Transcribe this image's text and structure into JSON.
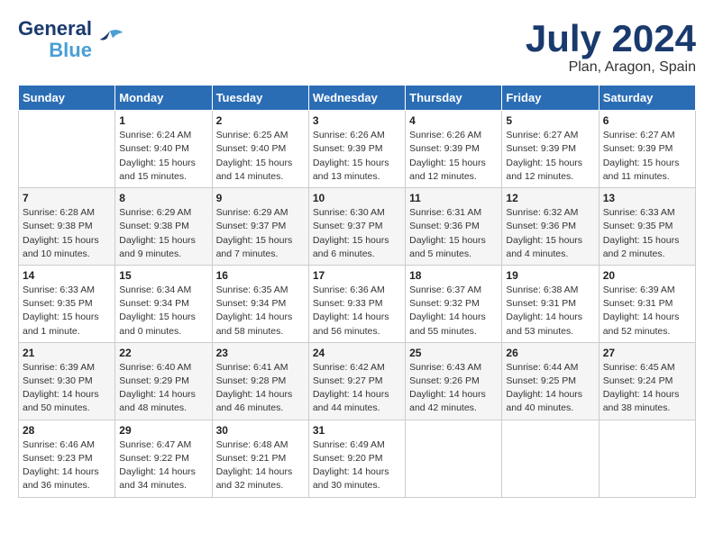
{
  "logo": {
    "line1": "General",
    "line2": "Blue"
  },
  "title": "July 2024",
  "location": "Plan, Aragon, Spain",
  "days_header": [
    "Sunday",
    "Monday",
    "Tuesday",
    "Wednesday",
    "Thursday",
    "Friday",
    "Saturday"
  ],
  "weeks": [
    [
      {
        "num": "",
        "info": ""
      },
      {
        "num": "1",
        "info": "Sunrise: 6:24 AM\nSunset: 9:40 PM\nDaylight: 15 hours\nand 15 minutes."
      },
      {
        "num": "2",
        "info": "Sunrise: 6:25 AM\nSunset: 9:40 PM\nDaylight: 15 hours\nand 14 minutes."
      },
      {
        "num": "3",
        "info": "Sunrise: 6:26 AM\nSunset: 9:39 PM\nDaylight: 15 hours\nand 13 minutes."
      },
      {
        "num": "4",
        "info": "Sunrise: 6:26 AM\nSunset: 9:39 PM\nDaylight: 15 hours\nand 12 minutes."
      },
      {
        "num": "5",
        "info": "Sunrise: 6:27 AM\nSunset: 9:39 PM\nDaylight: 15 hours\nand 12 minutes."
      },
      {
        "num": "6",
        "info": "Sunrise: 6:27 AM\nSunset: 9:39 PM\nDaylight: 15 hours\nand 11 minutes."
      }
    ],
    [
      {
        "num": "7",
        "info": "Sunrise: 6:28 AM\nSunset: 9:38 PM\nDaylight: 15 hours\nand 10 minutes."
      },
      {
        "num": "8",
        "info": "Sunrise: 6:29 AM\nSunset: 9:38 PM\nDaylight: 15 hours\nand 9 minutes."
      },
      {
        "num": "9",
        "info": "Sunrise: 6:29 AM\nSunset: 9:37 PM\nDaylight: 15 hours\nand 7 minutes."
      },
      {
        "num": "10",
        "info": "Sunrise: 6:30 AM\nSunset: 9:37 PM\nDaylight: 15 hours\nand 6 minutes."
      },
      {
        "num": "11",
        "info": "Sunrise: 6:31 AM\nSunset: 9:36 PM\nDaylight: 15 hours\nand 5 minutes."
      },
      {
        "num": "12",
        "info": "Sunrise: 6:32 AM\nSunset: 9:36 PM\nDaylight: 15 hours\nand 4 minutes."
      },
      {
        "num": "13",
        "info": "Sunrise: 6:33 AM\nSunset: 9:35 PM\nDaylight: 15 hours\nand 2 minutes."
      }
    ],
    [
      {
        "num": "14",
        "info": "Sunrise: 6:33 AM\nSunset: 9:35 PM\nDaylight: 15 hours\nand 1 minute."
      },
      {
        "num": "15",
        "info": "Sunrise: 6:34 AM\nSunset: 9:34 PM\nDaylight: 15 hours\nand 0 minutes."
      },
      {
        "num": "16",
        "info": "Sunrise: 6:35 AM\nSunset: 9:34 PM\nDaylight: 14 hours\nand 58 minutes."
      },
      {
        "num": "17",
        "info": "Sunrise: 6:36 AM\nSunset: 9:33 PM\nDaylight: 14 hours\nand 56 minutes."
      },
      {
        "num": "18",
        "info": "Sunrise: 6:37 AM\nSunset: 9:32 PM\nDaylight: 14 hours\nand 55 minutes."
      },
      {
        "num": "19",
        "info": "Sunrise: 6:38 AM\nSunset: 9:31 PM\nDaylight: 14 hours\nand 53 minutes."
      },
      {
        "num": "20",
        "info": "Sunrise: 6:39 AM\nSunset: 9:31 PM\nDaylight: 14 hours\nand 52 minutes."
      }
    ],
    [
      {
        "num": "21",
        "info": "Sunrise: 6:39 AM\nSunset: 9:30 PM\nDaylight: 14 hours\nand 50 minutes."
      },
      {
        "num": "22",
        "info": "Sunrise: 6:40 AM\nSunset: 9:29 PM\nDaylight: 14 hours\nand 48 minutes."
      },
      {
        "num": "23",
        "info": "Sunrise: 6:41 AM\nSunset: 9:28 PM\nDaylight: 14 hours\nand 46 minutes."
      },
      {
        "num": "24",
        "info": "Sunrise: 6:42 AM\nSunset: 9:27 PM\nDaylight: 14 hours\nand 44 minutes."
      },
      {
        "num": "25",
        "info": "Sunrise: 6:43 AM\nSunset: 9:26 PM\nDaylight: 14 hours\nand 42 minutes."
      },
      {
        "num": "26",
        "info": "Sunrise: 6:44 AM\nSunset: 9:25 PM\nDaylight: 14 hours\nand 40 minutes."
      },
      {
        "num": "27",
        "info": "Sunrise: 6:45 AM\nSunset: 9:24 PM\nDaylight: 14 hours\nand 38 minutes."
      }
    ],
    [
      {
        "num": "28",
        "info": "Sunrise: 6:46 AM\nSunset: 9:23 PM\nDaylight: 14 hours\nand 36 minutes."
      },
      {
        "num": "29",
        "info": "Sunrise: 6:47 AM\nSunset: 9:22 PM\nDaylight: 14 hours\nand 34 minutes."
      },
      {
        "num": "30",
        "info": "Sunrise: 6:48 AM\nSunset: 9:21 PM\nDaylight: 14 hours\nand 32 minutes."
      },
      {
        "num": "31",
        "info": "Sunrise: 6:49 AM\nSunset: 9:20 PM\nDaylight: 14 hours\nand 30 minutes."
      },
      {
        "num": "",
        "info": ""
      },
      {
        "num": "",
        "info": ""
      },
      {
        "num": "",
        "info": ""
      }
    ]
  ]
}
